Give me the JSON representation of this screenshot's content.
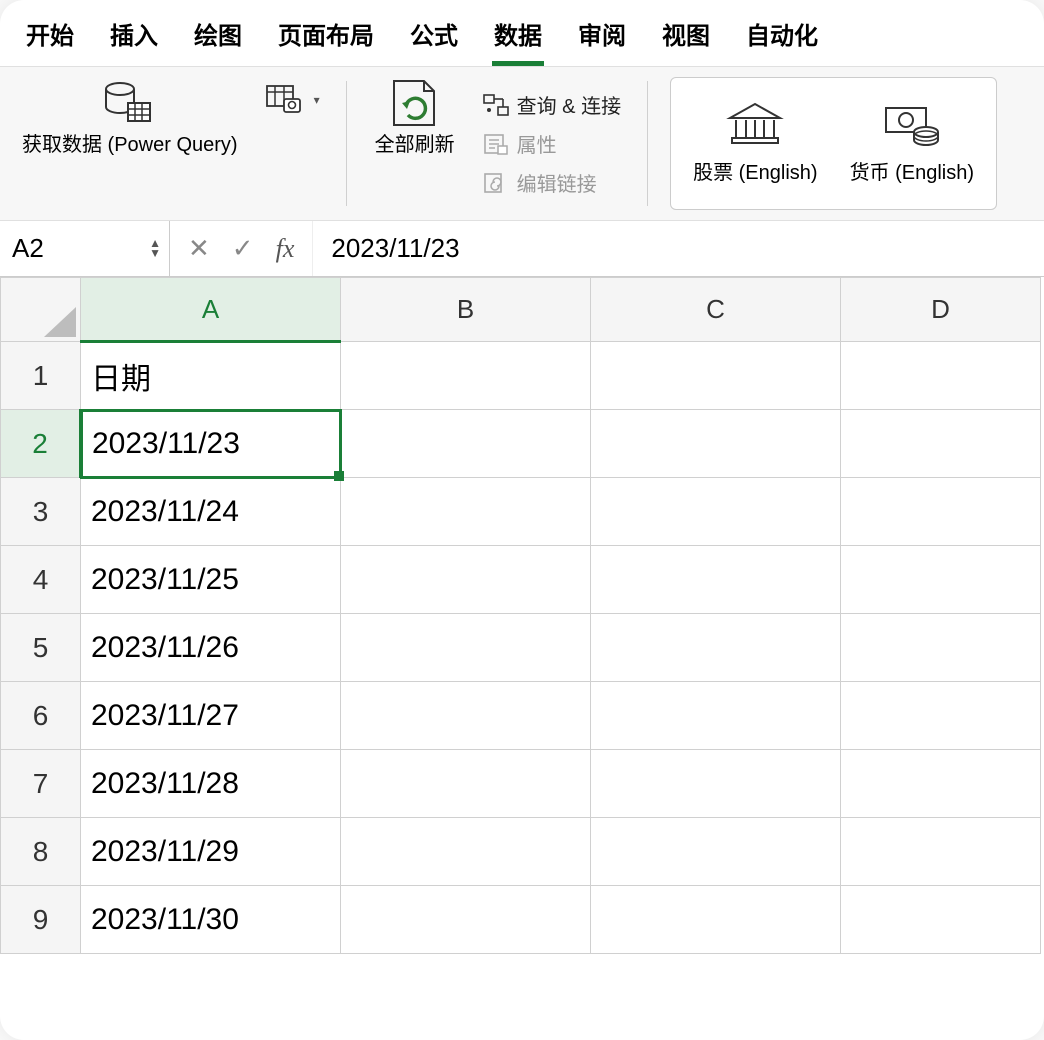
{
  "tabs": {
    "items": [
      "开始",
      "插入",
      "绘图",
      "页面布局",
      "公式",
      "数据",
      "审阅",
      "视图",
      "自动化"
    ],
    "active_index": 5
  },
  "ribbon": {
    "get_data": "获取数据 (Power Query)",
    "refresh_all": "全部刷新",
    "queries_connections": "查询 & 连接",
    "properties": "属性",
    "edit_links": "编辑链接",
    "stock": "股票 (English)",
    "currency": "货币 (English)"
  },
  "formula_bar": {
    "name_box": "A2",
    "fx_label": "fx",
    "formula": "2023/11/23"
  },
  "grid": {
    "columns": [
      "A",
      "B",
      "C",
      "D"
    ],
    "row_numbers": [
      "1",
      "2",
      "3",
      "4",
      "5",
      "6",
      "7",
      "8",
      "9"
    ],
    "selected_col_index": 0,
    "selected_row_index": 1,
    "cells": {
      "A1": "日期",
      "A2": "2023/11/23",
      "A3": "2023/11/24",
      "A4": "2023/11/25",
      "A5": "2023/11/26",
      "A6": "2023/11/27",
      "A7": "2023/11/28",
      "A8": "2023/11/29",
      "A9": "2023/11/30"
    }
  }
}
